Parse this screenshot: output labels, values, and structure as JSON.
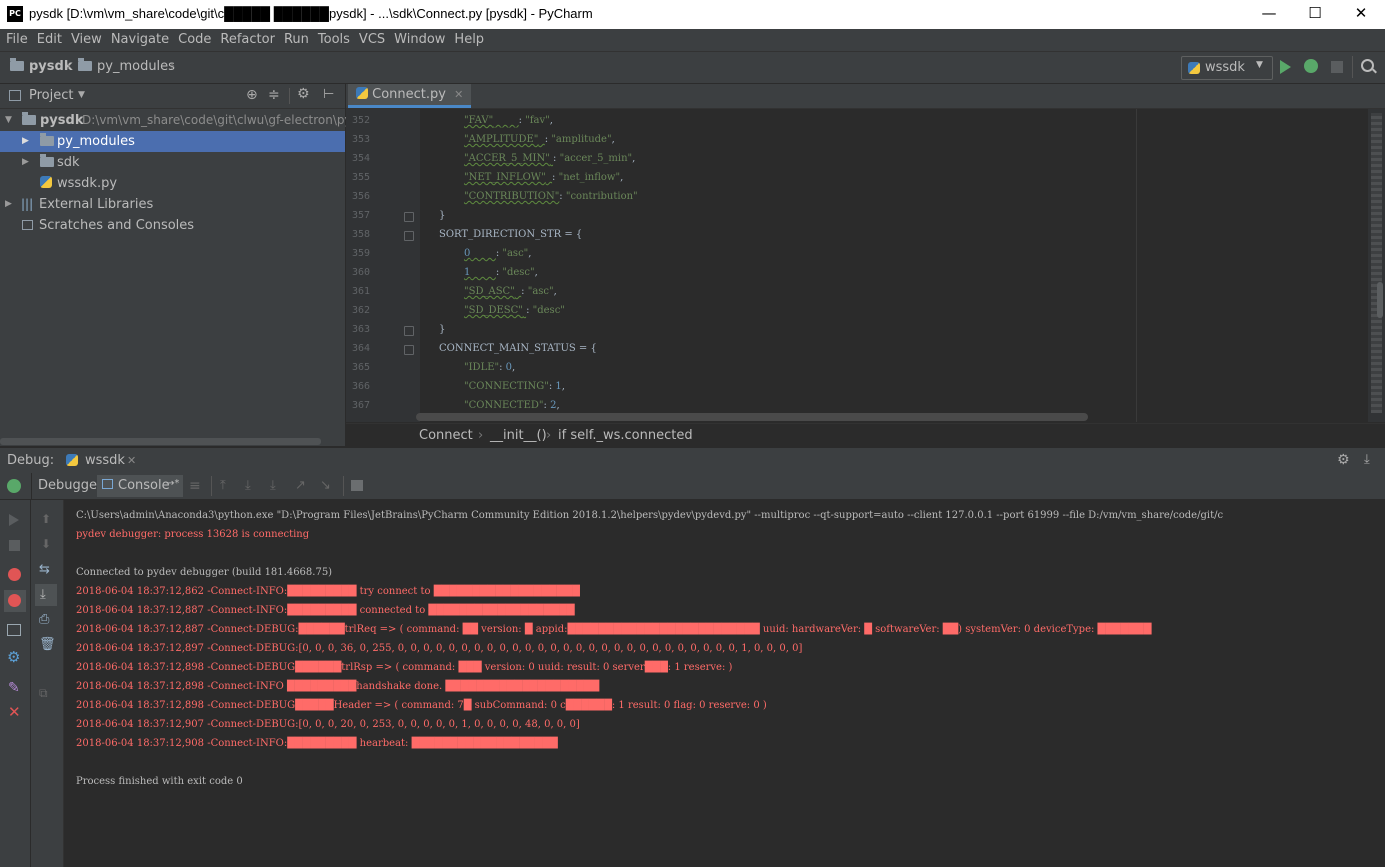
{
  "window": {
    "title": "pysdk [D:\\vm\\vm_share\\code\\git\\c█████ ██████pysdk] - ...\\sdk\\Connect.py [pysdk] - PyCharm",
    "logo": "PC",
    "minimize": "—",
    "maximize": "☐",
    "close": "✕"
  },
  "menu": [
    "File",
    "Edit",
    "View",
    "Navigate",
    "Code",
    "Refactor",
    "Run",
    "Tools",
    "VCS",
    "Window",
    "Help"
  ],
  "navbar": {
    "crumb1": "pysdk",
    "crumb2": "py_modules",
    "run_config": "wssdk"
  },
  "project_panel": {
    "title": "Project",
    "root_name": "pysdk",
    "root_path": "D:\\vm\\vm_share\\code\\git\\clwu\\gf-electron\\py",
    "items": [
      "py_modules",
      "sdk",
      "wssdk.py",
      "External Libraries",
      "Scratches and Consoles"
    ]
  },
  "editor": {
    "tab_label": "Connect.py",
    "line_numbers": [
      "352",
      "353",
      "354",
      "355",
      "356",
      "357",
      "358",
      "359",
      "360",
      "361",
      "362",
      "363",
      "364",
      "365",
      "366",
      "367"
    ],
    "breadcrumbs": [
      "Connect",
      "__init__()",
      "if self._ws.connected"
    ]
  },
  "debug": {
    "label": "Debug:",
    "session": "wssdk",
    "tab_debugger": "Debugger",
    "tab_console": "Console",
    "tab_console_arrow": "→*"
  },
  "console_lines": [
    {
      "t": "w",
      "text": "C:\\Users\\admin\\Anaconda3\\python.exe \"D:\\Program Files\\JetBrains\\PyCharm Community Edition 2018.1.2\\helpers\\pydev\\pydevd.py\" --multiproc --qt-support=auto --client 127.0.0.1 --port 61999 --file D:/vm/vm_share/code/git/c"
    },
    {
      "t": "r",
      "text": "pydev debugger: process 13628 is connecting"
    },
    {
      "t": "w",
      "text": ""
    },
    {
      "t": "w",
      "text": "Connected to pydev debugger (build 181.4668.75)"
    },
    {
      "t": "r",
      "text": "2018-06-04 18:37:12,862 -Connect-INFO:█████████ try connect to ███████████████████"
    },
    {
      "t": "r",
      "text": "2018-06-04 18:37:12,887 -Connect-INFO:█████████ connected to ███████████████████"
    },
    {
      "t": "r",
      "text": "2018-06-04 18:37:12,887 -Connect-DEBUG:██████trlReq => ( command: ██ version: █ appid:█████████████████████████ uuid:  hardwareVer: █ softwareVer: ██) systemVer: 0 deviceType: ███████"
    },
    {
      "t": "r",
      "text": "2018-06-04 18:37:12,897 -Connect-DEBUG:[0, 0, 0, 36, 0, 255, 0, 0, 0, 0, 0, 0, 0, 0, 0, 0, 0, 0, 0, 0, 0, 0, 0, 0, 0, 0, 0, 0, 0, 0, 0, 0, 0, 1, 0, 0, 0, 0]"
    },
    {
      "t": "r",
      "text": "2018-06-04 18:37:12,898 -Connect-DEBUG██████trlRsp => ( command: ███ version: 0 uuid:  result: 0 server███: 1 reserve:  )"
    },
    {
      "t": "r",
      "text": "2018-06-04 18:37:12,898 -Connect-INFO █████████handshake done. ████████████████████"
    },
    {
      "t": "r",
      "text": "2018-06-04 18:37:12,898 -Connect-DEBUG█████Header => ( command: 7█ subCommand: 0 c██████: 1 result: 0 flag: 0 reserve: 0 )"
    },
    {
      "t": "r",
      "text": "2018-06-04 18:37:12,907 -Connect-DEBUG:[0, 0, 0, 20, 0, 253, 0, 0, 0, 0, 0, 1, 0, 0, 0, 0, 48, 0, 0, 0]"
    },
    {
      "t": "r",
      "text": "2018-06-04 18:37:12,908 -Connect-INFO:█████████ hearbeat: ███████████████████"
    },
    {
      "t": "w",
      "text": ""
    },
    {
      "t": "w",
      "text": "Process finished with exit code 0"
    }
  ],
  "code": {
    "l352_k": "\"FAV\"",
    "l352_v": "\"fav\"",
    "l353_k": "\"AMPLITUDE\"",
    "l353_v": "\"amplitude\"",
    "l354_k": "\"ACCER_5_MIN\"",
    "l354_v": "\"accer_5_min\"",
    "l355_k": "\"NET_INFLOW\"",
    "l355_v": "\"net_inflow\"",
    "l356_k": "\"CONTRIBUTION\"",
    "l356_v": "\"contribution\"",
    "l357": "}",
    "l358": "SORT_DIRECTION_STR = {",
    "l359_k": "0",
    "l359_v": "\"asc\"",
    "l360_k": "1",
    "l360_v": "\"desc\"",
    "l361_k": "\"SD_ASC\"",
    "l361_v": "\"asc\"",
    "l362_k": "\"SD_DESC\"",
    "l362_v": "\"desc\"",
    "l363": "}",
    "l364": "CONNECT_MAIN_STATUS = {",
    "l365_k": "\"IDLE\"",
    "l365_v": "0",
    "l366_k": "\"CONNECTING\"",
    "l366_v": "1",
    "l367_k": "\"CONNECTED\"",
    "l367_v": "2"
  },
  "colors": {
    "accent": "#4b6eaf",
    "console_error": "#ff6b68",
    "run_green": "#59a869",
    "stop_red": "#e05555"
  }
}
